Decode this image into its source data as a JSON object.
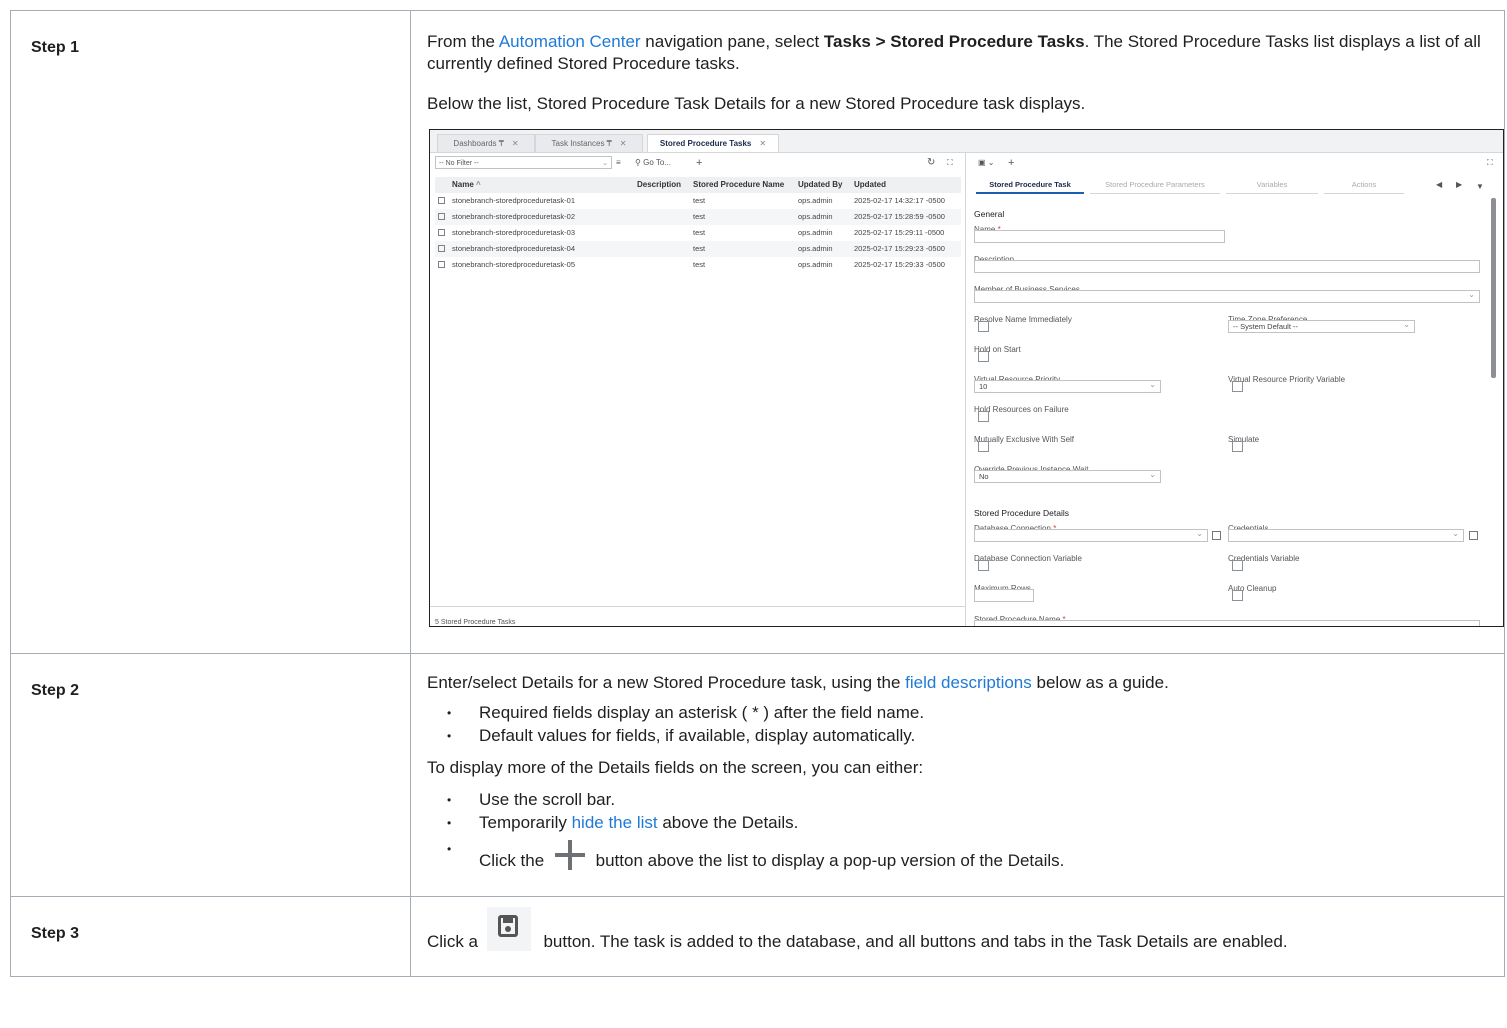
{
  "step1": {
    "label": "Step 1",
    "p1_pre": "From the ",
    "p1_link": "Automation Center",
    "p1_mid": " navigation pane, select ",
    "p1_bold": "Tasks > Stored Procedure Tasks",
    "p1_post": ". The Stored Procedure Tasks list displays a list of all currently defined Stored Procedure tasks.",
    "p2": "Below the list, Stored Procedure Task Details for a new Stored Procedure task displays."
  },
  "screenshot": {
    "tabs": [
      "Dashboards ₸",
      "Task Instances ₸",
      "Stored Procedure Tasks"
    ],
    "filter": "-- No Filter --",
    "go_to": "Go To...",
    "columns": [
      "Name",
      "Description",
      "Stored Procedure Name",
      "Updated By",
      "Updated"
    ],
    "rows": [
      {
        "name": "stonebranch-storedproceduretask-01",
        "sp": "test",
        "by": "ops.admin",
        "updated": "2025-02-17 14:32:17 -0500"
      },
      {
        "name": "stonebranch-storedproceduretask-02",
        "sp": "test",
        "by": "ops.admin",
        "updated": "2025-02-17 15:28:59 -0500"
      },
      {
        "name": "stonebranch-storedproceduretask-03",
        "sp": "test",
        "by": "ops.admin",
        "updated": "2025-02-17 15:29:11 -0500"
      },
      {
        "name": "stonebranch-storedproceduretask-04",
        "sp": "test",
        "by": "ops.admin",
        "updated": "2025-02-17 15:29:23 -0500"
      },
      {
        "name": "stonebranch-storedproceduretask-05",
        "sp": "test",
        "by": "ops.admin",
        "updated": "2025-02-17 15:29:33 -0500"
      }
    ],
    "count": "5 Stored Procedure Tasks",
    "detail_tabs": [
      "Stored Procedure Task",
      "Stored Procedure Parameters",
      "Variables",
      "Actions"
    ],
    "general": "General",
    "name_label": "Name",
    "description_label": "Description",
    "member_label": "Member of Business Services",
    "resolve_label": "Resolve Name Immediately",
    "tz_label": "Time Zone Preference",
    "tz_value": "-- System Default --",
    "hold_start_label": "Hold on Start",
    "vrp_label": "Virtual Resource Priority",
    "vrp_value": "10",
    "vrp_var_label": "Virtual Resource Priority Variable",
    "hold_fail_label": "Hold Resources on Failure",
    "mutex_label": "Mutually Exclusive With Self",
    "simulate_label": "Simulate",
    "override_label": "Override Previous Instance Wait",
    "override_value": "No",
    "spd_section": "Stored Procedure Details",
    "db_conn_label": "Database Connection",
    "cred_label": "Credentials",
    "db_conn_var_label": "Database Connection Variable",
    "cred_var_label": "Credentials Variable",
    "max_rows_label": "Maximum Rows",
    "auto_cleanup_label": "Auto Cleanup",
    "sp_name_label": "Stored Procedure Name",
    "required_mark": "*"
  },
  "step2": {
    "label": "Step 2",
    "p1_pre": "Enter/select Details for a new Stored Procedure task, using the ",
    "p1_link": "field descriptions",
    "p1_post": " below as a guide.",
    "b1": "Required fields display an asterisk ( * ) after the field name.",
    "b2": "Default values for fields, if available, display automatically.",
    "p2": "To display more of the Details fields on the screen, you can either:",
    "b3": "Use the scroll bar.",
    "b4_pre": "Temporarily ",
    "b4_link": "hide the list",
    "b4_post": " above the Details.",
    "b5_pre": "Click the ",
    "b5_post": " button above the list to display a pop-up version of the Details."
  },
  "step3": {
    "label": "Step 3",
    "p_pre": "Click a ",
    "p_post": " button. The task is added to the database, and all buttons and tabs in the Task Details are enabled."
  }
}
